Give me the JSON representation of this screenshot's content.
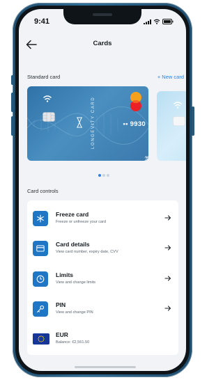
{
  "status_bar": {
    "time": "9:41"
  },
  "header": {
    "title": "Cards"
  },
  "cards_section": {
    "label": "Standard card",
    "new_card_label": "+ New card",
    "card": {
      "brand_text": "LONGEVITY CARD",
      "number_masked": "•• 9930",
      "type": "debit"
    },
    "carousel": {
      "total": 3,
      "active_index": 0
    }
  },
  "controls": {
    "label": "Card controls",
    "items": [
      {
        "title": "Freeze card",
        "subtitle": "Freeze or unfreeze your card",
        "icon": "snowflake-icon"
      },
      {
        "title": "Card details",
        "subtitle": "View card number, expiry date, CVV",
        "icon": "card-icon"
      },
      {
        "title": "Limits",
        "subtitle": "View and change limits",
        "icon": "gauge-icon"
      },
      {
        "title": "PIN",
        "subtitle": "View and change PIN",
        "icon": "key-icon"
      },
      {
        "title": "EUR",
        "subtitle": "Balance: €2,561.50",
        "icon": "eu-flag-icon"
      }
    ]
  },
  "colors": {
    "accent": "#2f83e0",
    "icon_bg": "#1f76c4",
    "card_blue": "#3b79ad"
  }
}
